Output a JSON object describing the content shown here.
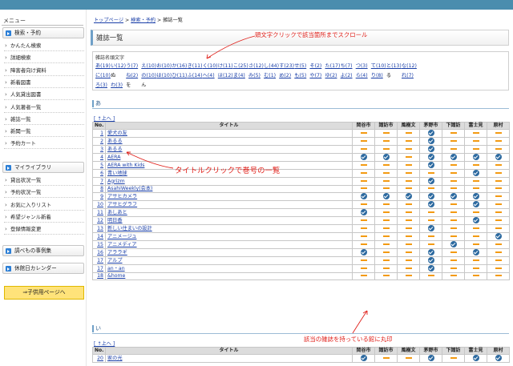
{
  "sidebar": {
    "menu_title": "メニュー",
    "sections": [
      {
        "label": "検索・予約",
        "items": [
          "かんたん検索",
          "詳細検索",
          "障害者向け資料",
          "新着図書",
          "人気貸出図書",
          "人気著者一覧",
          "雑誌一覧",
          "新聞一覧",
          "予約カート"
        ]
      },
      {
        "label": "マイライブラリ",
        "items": [
          "貸出状況一覧",
          "予約状況一覧",
          "お気に入りリスト",
          "希望ジャンル新着",
          "登録情報変更"
        ]
      },
      {
        "label": "調べもの事例集",
        "items": []
      },
      {
        "label": "休館日カレンダー",
        "items": []
      }
    ],
    "kids_link": "⇒子供用ページへ"
  },
  "breadcrumb": {
    "home": "トップページ",
    "search": "検索・予約",
    "current": "雑誌一覧",
    "sep": ">"
  },
  "page_title": "雑誌一覧",
  "index": {
    "label": "雑誌名頭文字",
    "rows": [
      [
        "あ(19)",
        "い(12)",
        "う(7)",
        "え(10)",
        "お(10)",
        "か(16)",
        "き(11)",
        "く(10)",
        "け(11)",
        "こ(25)",
        "さ(12)",
        "し(44)",
        "す(23)",
        "せ(5)",
        "そ(2)",
        "た(17)",
        "ち(7)",
        "つ(3)",
        "て(10)",
        "と(13)",
        "な(12)"
      ],
      [
        "に(10)",
        "ぬ",
        "ね(2)",
        "の(10)",
        "は(10)",
        "ひ(11)",
        "ふ(14)",
        "へ(4)",
        "ほ(12)",
        "ま(4)",
        "み(5)",
        "む(1)",
        "め(2)",
        "も(5)",
        "や(7)",
        "ゆ(2)",
        "よ(2)",
        "ら(4)",
        "り(8)",
        "る",
        "れ(7)"
      ],
      [
        "ろ(3)",
        "わ(3)",
        "を",
        "ん"
      ]
    ]
  },
  "to_top": "[ ↑上へ ]",
  "table_headers": [
    "No.",
    "タイトル",
    "岡谷市",
    "諏訪市",
    "風樹文",
    "茅野市",
    "下諏訪",
    "富士見",
    "原村"
  ],
  "sections": [
    {
      "heading": "あ",
      "rows": [
        {
          "no": "1",
          "title": "愛犬の友",
          "marks": [
            0,
            0,
            0,
            1,
            0,
            0,
            0
          ]
        },
        {
          "no": "2",
          "title": "あるる",
          "marks": [
            0,
            0,
            0,
            1,
            0,
            0,
            0
          ]
        },
        {
          "no": "3",
          "title": "あるる",
          "marks": [
            0,
            0,
            0,
            1,
            0,
            0,
            0
          ]
        },
        {
          "no": "4",
          "title": "AERA",
          "marks": [
            1,
            1,
            0,
            1,
            1,
            1,
            1
          ]
        },
        {
          "no": "5",
          "title": "AERA with Kids",
          "marks": [
            0,
            0,
            0,
            1,
            0,
            0,
            0
          ]
        },
        {
          "no": "6",
          "title": "青い地球",
          "marks": [
            0,
            0,
            0,
            0,
            0,
            1,
            0
          ]
        },
        {
          "no": "7",
          "title": "Agrizm",
          "marks": [
            0,
            0,
            0,
            1,
            0,
            0,
            0
          ]
        },
        {
          "no": "8",
          "title": "AsahiWeekly(会本)",
          "marks": [
            0,
            0,
            0,
            0,
            0,
            0,
            0
          ]
        },
        {
          "no": "9",
          "title": "アサヒカメラ",
          "marks": [
            1,
            1,
            1,
            1,
            1,
            1,
            0
          ]
        },
        {
          "no": "10",
          "title": "アサヒグラフ",
          "marks": [
            0,
            0,
            0,
            1,
            0,
            1,
            0
          ]
        },
        {
          "no": "11",
          "title": "あしあと",
          "marks": [
            1,
            0,
            0,
            0,
            0,
            0,
            0
          ]
        },
        {
          "no": "12",
          "title": "明日香",
          "marks": [
            0,
            0,
            0,
            0,
            0,
            1,
            0
          ]
        },
        {
          "no": "13",
          "title": "新しい住まいの設計",
          "marks": [
            0,
            0,
            0,
            1,
            0,
            0,
            0
          ]
        },
        {
          "no": "14",
          "title": "アニメージュ",
          "marks": [
            0,
            0,
            0,
            0,
            0,
            0,
            1
          ]
        },
        {
          "no": "15",
          "title": "アニメディア",
          "marks": [
            0,
            0,
            0,
            0,
            1,
            0,
            0
          ]
        },
        {
          "no": "16",
          "title": "アララギ",
          "marks": [
            1,
            0,
            0,
            1,
            0,
            1,
            0
          ]
        },
        {
          "no": "17",
          "title": "アルプ",
          "marks": [
            0,
            0,
            0,
            1,
            0,
            0,
            0
          ]
        },
        {
          "no": "17",
          "title": "an・an",
          "marks": [
            0,
            0,
            0,
            1,
            0,
            0,
            0
          ]
        },
        {
          "no": "18",
          "title": "&home",
          "marks": [
            0,
            0,
            0,
            0,
            0,
            0,
            0
          ]
        }
      ]
    },
    {
      "heading": "い",
      "rows": [
        {
          "no": "20",
          "title": "家の光",
          "marks": [
            1,
            0,
            0,
            1,
            0,
            1,
            1
          ]
        }
      ]
    }
  ],
  "annotations": {
    "header_click": "頭文字クリックで該当箇所までスクロール",
    "title_click": "タイトルクリックで巻号の一覧",
    "holding": "該当の雑誌を持っている館に丸印"
  },
  "colors": {
    "topbar": "#4a8dae",
    "link": "#1a3fa8",
    "annotation": "#e0201a",
    "check": "#2d6aa0",
    "dash": "#f39a12"
  }
}
